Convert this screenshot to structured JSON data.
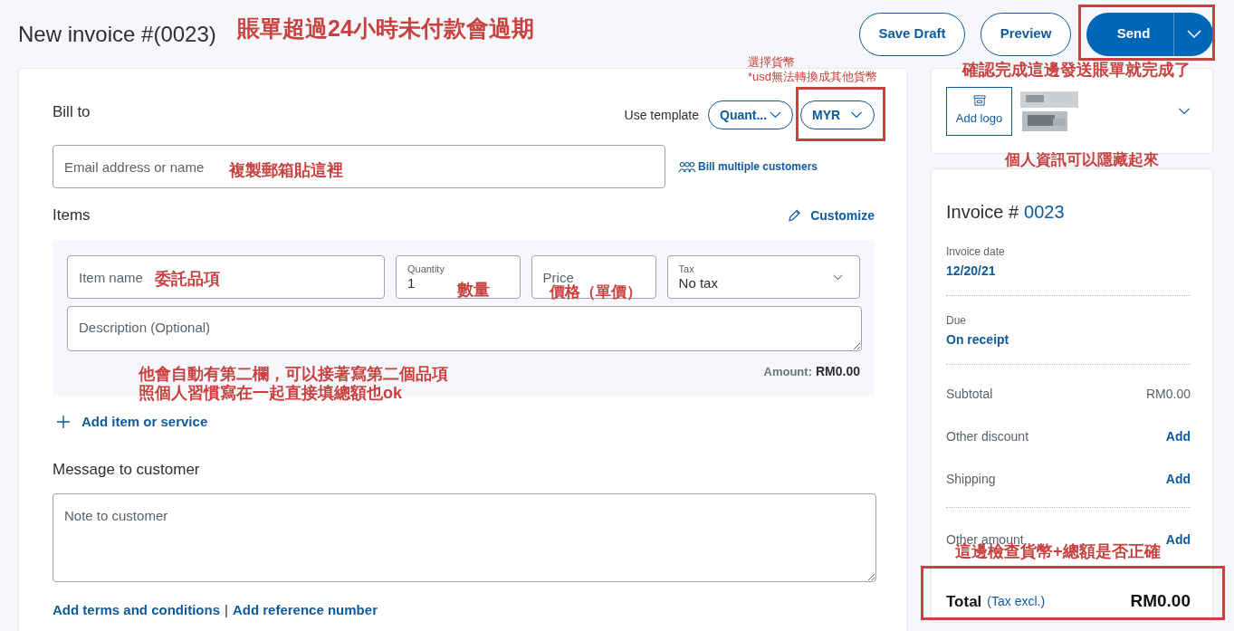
{
  "header": {
    "title": "New invoice #(0023)",
    "buttons": [
      {
        "label": "Save Draft",
        "kind": "outline"
      },
      {
        "label": "Preview",
        "kind": "outline"
      },
      {
        "label": "Send",
        "kind": "primary"
      }
    ]
  },
  "bill_to": {
    "heading": "Bill to",
    "template_label": "Use template",
    "template_value": "Quant...",
    "currency": "MYR",
    "recipient_placeholder": "Email address or name",
    "bill_multiple": "Bill multiple customers"
  },
  "items": {
    "heading": "Items",
    "customize": "Customize",
    "fields": [
      {
        "kind": "text",
        "placeholder": "Item name"
      },
      {
        "kind": "labeled",
        "label": "Quantity",
        "value": "1"
      },
      {
        "kind": "text",
        "placeholder": "Price"
      },
      {
        "kind": "select",
        "label": "Tax",
        "value": "No tax"
      }
    ],
    "description_placeholder": "Description (Optional)",
    "amount_label": "Amount:",
    "amount_value": "RM0.00",
    "add_item": "Add item or service"
  },
  "message": {
    "heading": "Message to customer",
    "placeholder": "Note to customer"
  },
  "footer_links": {
    "links": [
      "Add terms and conditions",
      "Add reference number"
    ],
    "separator": "|"
  },
  "business": {
    "add_logo": "Add logo"
  },
  "summary": {
    "title": "Invoice #",
    "number": "0023",
    "fields": [
      {
        "label": "Invoice date",
        "value": "12/20/21"
      },
      {
        "label": "Due",
        "value": "On receipt"
      }
    ],
    "lines": [
      {
        "label": "Subtotal",
        "value": "RM0.00",
        "kind": "amount"
      },
      {
        "label": "Other discount",
        "value": "Add",
        "kind": "action"
      },
      {
        "label": "Shipping",
        "value": "Add",
        "kind": "action"
      },
      {
        "label": "Other amount",
        "value": "Add",
        "kind": "action"
      }
    ],
    "total_label": "Total",
    "total_note": "(Tax excl.)",
    "total_value": "RM0.00"
  },
  "annotations": [
    "賬單超過24小時未付款會過期",
    "選擇貨幣",
    "*usd無法轉換成其他貨幣",
    "確認完成這邊發送賬單就完成了",
    "個人資訊可以隱藏起來",
    "複製郵箱貼這裡",
    "委託品項",
    "數量",
    "價格（單價）",
    "他會自動有第二欄，可以接著寫第二個品項",
    "照個人習慣寫在一起直接填總額也ok",
    "這邊檢查貨幣+總額是否正確"
  ]
}
